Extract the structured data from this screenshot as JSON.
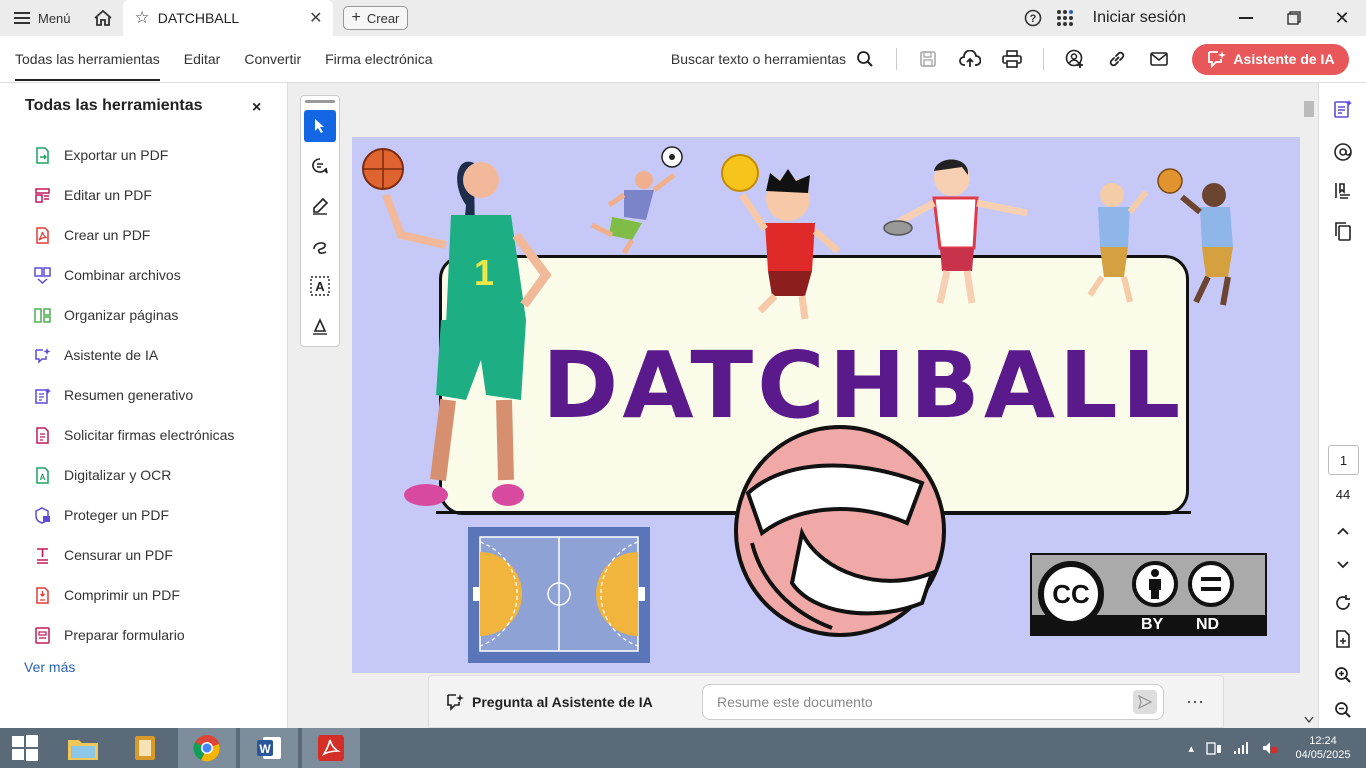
{
  "titlebar": {
    "menu_label": "Menú",
    "tab_title": "DATCHBALL",
    "create_label": "Crear",
    "signin_label": "Iniciar sesión"
  },
  "toolbar": {
    "tabs": [
      {
        "label": "Todas las herramientas"
      },
      {
        "label": "Editar"
      },
      {
        "label": "Convertir"
      },
      {
        "label": "Firma electrónica"
      }
    ],
    "search_label": "Buscar texto o herramientas",
    "ai_button_label": "Asistente de IA"
  },
  "left_panel": {
    "title": "Todas las herramientas",
    "close": "×",
    "items": [
      {
        "label": "Exportar un PDF",
        "icon": "export-pdf-icon",
        "color": "#1aa260"
      },
      {
        "label": "Editar un PDF",
        "icon": "edit-pdf-icon",
        "color": "#c2185b"
      },
      {
        "label": "Crear un PDF",
        "icon": "create-pdf-icon",
        "color": "#e53935"
      },
      {
        "label": "Combinar archivos",
        "icon": "combine-files-icon",
        "color": "#5c4bd8"
      },
      {
        "label": "Organizar páginas",
        "icon": "organize-pages-icon",
        "color": "#4caf50"
      },
      {
        "label": "Asistente de IA",
        "icon": "ai-assistant-icon",
        "color": "#5c4bd8"
      },
      {
        "label": "Resumen generativo",
        "icon": "generative-summary-icon",
        "color": "#5c4bd8"
      },
      {
        "label": "Solicitar firmas electrónicas",
        "icon": "request-signatures-icon",
        "color": "#c2185b"
      },
      {
        "label": "Digitalizar y OCR",
        "icon": "scan-ocr-icon",
        "color": "#1aa260"
      },
      {
        "label": "Proteger un PDF",
        "icon": "protect-pdf-icon",
        "color": "#5c4bd8"
      },
      {
        "label": "Censurar un PDF",
        "icon": "redact-pdf-icon",
        "color": "#c2185b"
      },
      {
        "label": "Comprimir un PDF",
        "icon": "compress-pdf-icon",
        "color": "#e53935"
      },
      {
        "label": "Preparar formulario",
        "icon": "prepare-form-icon",
        "color": "#c2185b"
      }
    ],
    "more_label": "Ver más"
  },
  "document": {
    "title": "DATCHBALL",
    "cc_by": "BY",
    "cc_nd": "ND",
    "cc_mark": "CC"
  },
  "ai_bar": {
    "label": "Pregunta al Asistente de IA",
    "placeholder": "Resume este documento",
    "more": "···"
  },
  "navigation": {
    "current_page": "1",
    "total_pages": "44"
  },
  "taskbar": {
    "time": "12:24",
    "date": "04/05/2025"
  },
  "colors": {
    "accent": "#1467e4",
    "ai_button": "#e8575a",
    "page_bg": "#c6c9f7",
    "title_purple": "#5a1a8c",
    "taskbar": "#5a6a78"
  }
}
